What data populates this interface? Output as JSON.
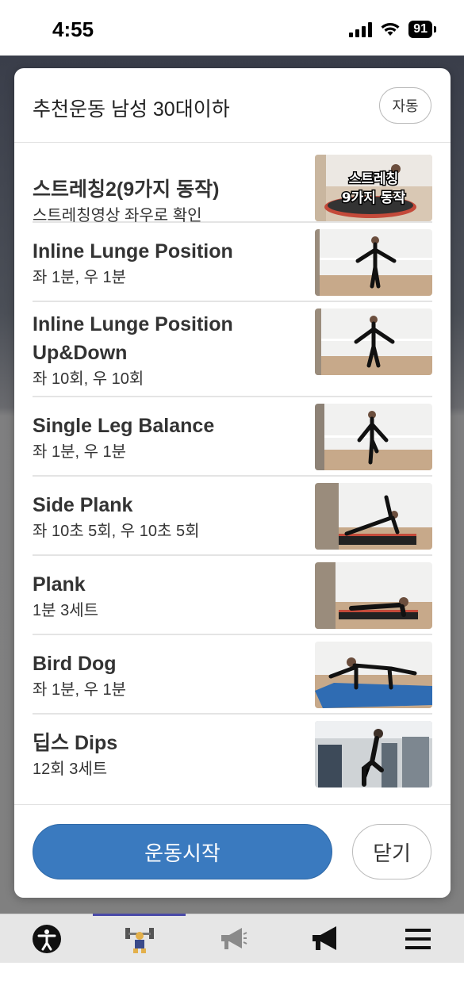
{
  "status_bar": {
    "time": "4:55",
    "battery": "91"
  },
  "modal": {
    "title": "추천운동 남성 30대이하",
    "auto_label": "자동",
    "exercises": [
      {
        "title": "스트레칭2(9가지 동작)",
        "subtitle": "스트레칭영상 좌우로 확인",
        "thumb_caption": [
          "스트레칭",
          "9가지 동작"
        ]
      },
      {
        "title": "Inline Lunge Position",
        "subtitle": "좌 1분, 우 1분"
      },
      {
        "title": "Inline Lunge Position Up&Down",
        "subtitle": "좌 10회, 우 10회"
      },
      {
        "title": "Single Leg Balance",
        "subtitle": "좌 1분, 우 1분"
      },
      {
        "title": "Side Plank",
        "subtitle": "좌 10초 5회, 우 10초 5회"
      },
      {
        "title": "Plank",
        "subtitle": "1분 3세트"
      },
      {
        "title": "Bird Dog",
        "subtitle": "좌 1분, 우 1분"
      },
      {
        "title": "딥스 Dips",
        "subtitle": "12회 3세트"
      }
    ],
    "start_label": "운동시작",
    "close_label": "닫기"
  },
  "tabbar": {
    "tabs": [
      {
        "icon": "accessibility-icon"
      },
      {
        "icon": "weightlifter-icon",
        "active": true
      },
      {
        "icon": "megaphone-outline-icon"
      },
      {
        "icon": "megaphone-icon"
      },
      {
        "icon": "hamburger-menu-icon"
      }
    ]
  },
  "colors": {
    "accent": "#3a7abf",
    "tab_indicator": "#4a4aa8"
  }
}
